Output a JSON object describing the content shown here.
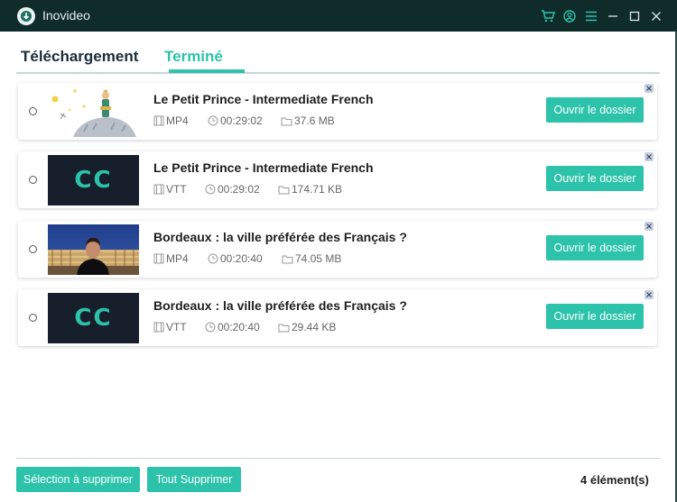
{
  "app": {
    "title": "Inovideo"
  },
  "tabs": [
    {
      "label": "Téléchargement",
      "active": false
    },
    {
      "label": "Terminé",
      "active": true
    }
  ],
  "items": [
    {
      "title": "Le Petit Prince - Intermediate French",
      "format": "MP4",
      "duration": "00:29:02",
      "size": "37.6 MB",
      "thumb": "petit-prince-illustration",
      "button": "Ouvrir le dossier"
    },
    {
      "title": "Le Petit Prince - Intermediate French",
      "format": "VTT",
      "duration": "00:29:02",
      "size": "174.71 KB",
      "thumb": "cc",
      "thumb_text": "CC",
      "button": "Ouvrir le dossier"
    },
    {
      "title": "Bordeaux : la ville préférée des Français ?",
      "format": "MP4",
      "duration": "00:20:40",
      "size": "74.05 MB",
      "thumb": "bordeaux-photo",
      "button": "Ouvrir le dossier"
    },
    {
      "title": "Bordeaux : la ville préférée des Français ?",
      "format": "VTT",
      "duration": "00:20:40",
      "size": "29.44 KB",
      "thumb": "cc",
      "thumb_text": "CC",
      "button": "Ouvrir le dossier"
    }
  ],
  "footer": {
    "delete_selected": "Sélection à supprimer",
    "delete_all": "Tout Supprimer",
    "count": "4 élément(s)"
  },
  "colors": {
    "accent": "#2cc3aa",
    "titlebar": "#0f2b2a",
    "cc_bg": "#171e2c"
  }
}
